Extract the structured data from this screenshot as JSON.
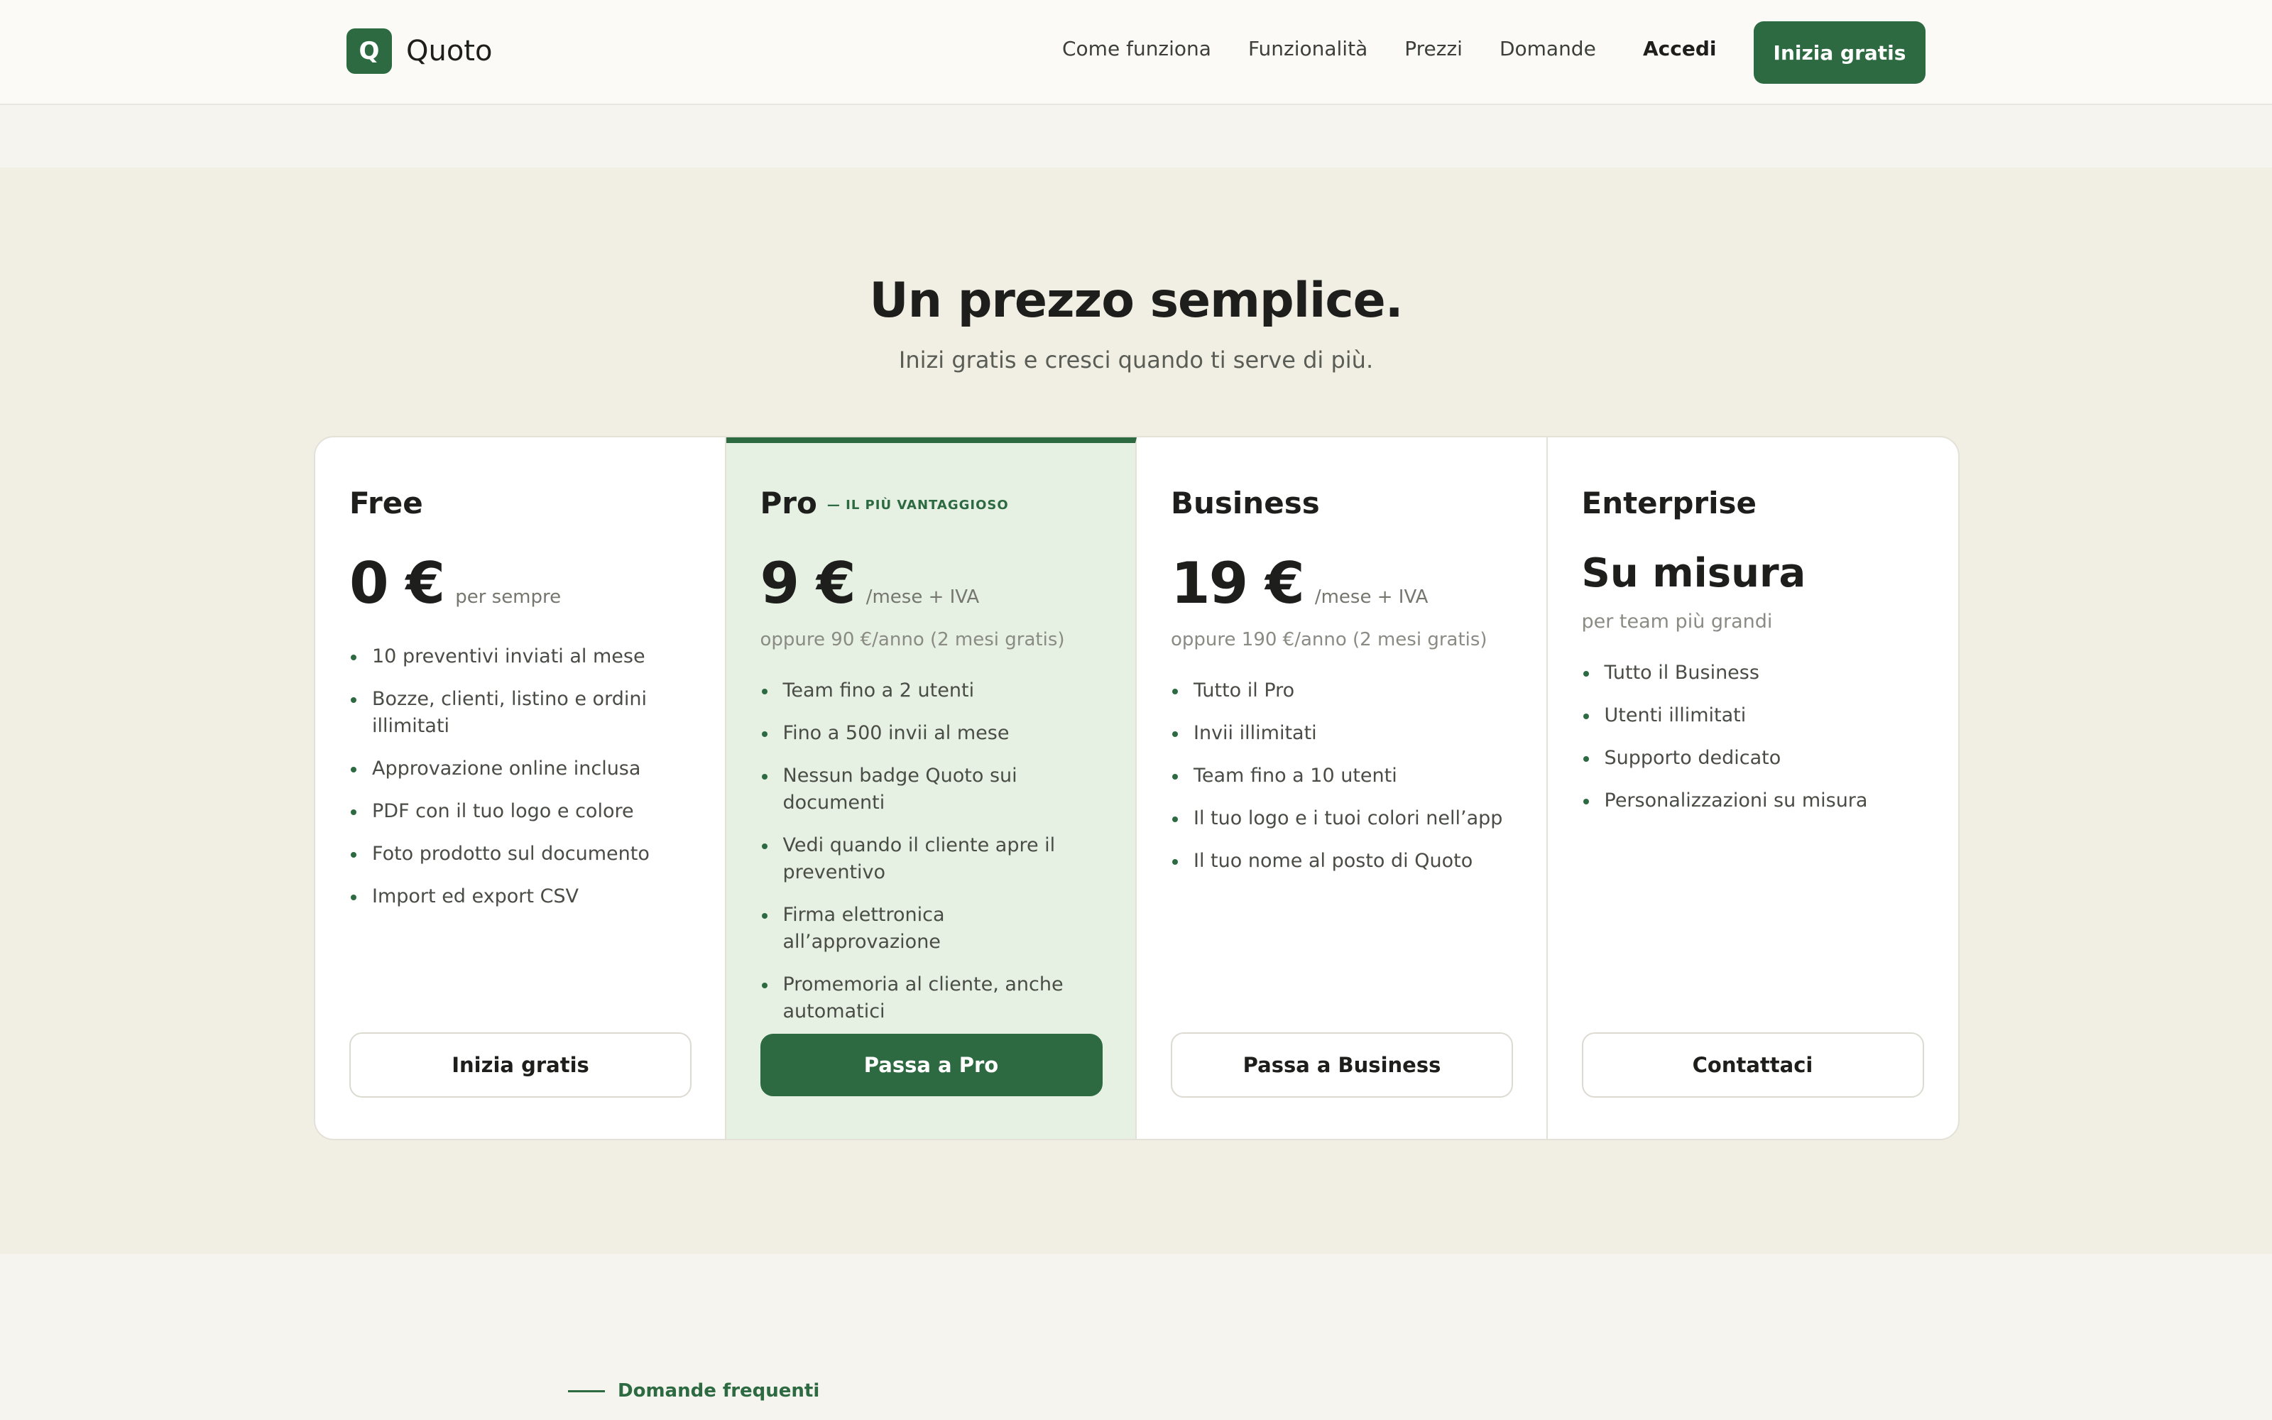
{
  "brand": {
    "logo_letter": "Q",
    "name": "Quoto",
    "accent_color": "#2d6a42"
  },
  "nav": {
    "links": [
      "Come funziona",
      "Funzionalità",
      "Prezzi",
      "Domande"
    ],
    "login_label": "Accedi",
    "cta_label": "Inizia gratis"
  },
  "pricing": {
    "title": "Un prezzo semplice.",
    "subtitle": "Inizi gratis e cresci quando ti serve di più.",
    "plans": [
      {
        "name": "Free",
        "price": "0 €",
        "price_note": "per sempre",
        "features": [
          "10 preventivi inviati al mese",
          "Bozze, clienti, listino e ordini illimitati",
          "Approvazione online inclusa",
          "PDF con il tuo logo e colore",
          "Foto prodotto sul documento",
          "Import ed export CSV"
        ],
        "button_label": "Inizia gratis"
      },
      {
        "name": "Pro",
        "tag": "— IL PIÙ VANTAGGIOSO",
        "price": "9 €",
        "price_note": "/mese + IVA",
        "yearly": "oppure 90 €/anno (2 mesi gratis)",
        "features": [
          "Team fino a 2 utenti",
          "Fino a 500 invii al mese",
          "Nessun badge Quoto sui documenti",
          "Vedi quando il cliente apre il preventivo",
          "Firma elettronica all’approvazione",
          "Promemoria al cliente, anche automatici"
        ],
        "button_label": "Passa a Pro"
      },
      {
        "name": "Business",
        "price": "19 €",
        "price_note": "/mese + IVA",
        "yearly": "oppure 190 €/anno (2 mesi gratis)",
        "features": [
          "Tutto il Pro",
          "Invii illimitati",
          "Team fino a 10 utenti",
          "Il tuo logo e i tuoi colori nell’app",
          "Il tuo nome al posto di Quoto"
        ],
        "button_label": "Passa a Business"
      },
      {
        "name": "Enterprise",
        "price": "Su misura",
        "price_note": "per team più grandi",
        "features": [
          "Tutto il Business",
          "Utenti illimitati",
          "Supporto dedicato",
          "Personalizzazioni su misura"
        ],
        "button_label": "Contattaci"
      }
    ]
  },
  "faq": {
    "eyebrow": "Domande frequenti"
  }
}
